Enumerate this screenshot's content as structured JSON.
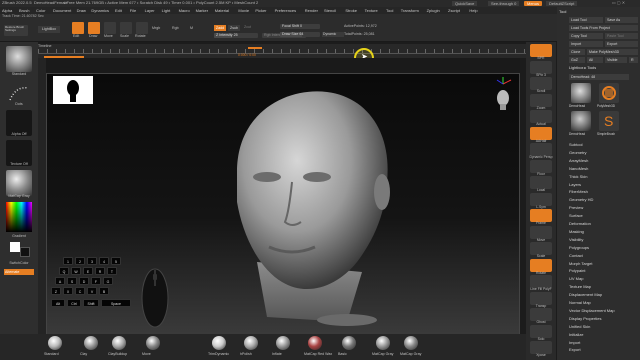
{
  "titlebar": {
    "app": "ZBrush 2022.0.5",
    "doc": "DemoHeadFemale",
    "stats": "• Free Mem 21.769GB • Active Mem 677 • Scratch Disk 49 • Timer 0.001 • PolyCount 2.5M KP • MeshCount 2",
    "quicksave": "QuickSave",
    "see_through": "See-through  0",
    "menus_btn": "Menus",
    "default_script": "DefaultZScript"
  },
  "menubar": [
    "Alpha",
    "Brush",
    "Color",
    "Document",
    "Draw",
    "Dynamics",
    "Edit",
    "File",
    "Layer",
    "Light",
    "Macro",
    "Marker",
    "Material",
    "Movie",
    "Picker",
    "Preferences",
    "Render",
    "Stencil",
    "Stroke",
    "Texture",
    "Tool",
    "Transform",
    "Zplugin",
    "Zscript",
    "Help"
  ],
  "track_time": "Track Time: 21.60782 Sec",
  "shelf": {
    "project_btn": "Restore Brush Settings",
    "lightbox": "LightBox",
    "buttons": [
      "Edit",
      "Draw",
      "Move",
      "Scale",
      "Rotate"
    ],
    "mrgb": "Mrgb",
    "rgb": "Rgb",
    "m": "M",
    "zadd": "Zadd",
    "zsub": "Zsub",
    "zcut": "Zcut",
    "focal_shift": "Focal Shift 0",
    "draw_size": "Draw Size 64",
    "dynamic": "Dynamic",
    "z_intensity": "Z Intensity 25",
    "rgb_intensity": "Rgb Intensity",
    "active_points": "ActivePoints: 12,972",
    "total_points": "TotalPoints: 25,081"
  },
  "timeline": {
    "label": "Timeline",
    "readout": "0:000 / 0:00"
  },
  "left_tray": {
    "brush_label": "Standard",
    "stroke_label": "Dots",
    "alpha_label": "Alpha Off",
    "texture_label": "Texture Off",
    "material_label": "MatCap Gray",
    "gradient_label": "Gradient",
    "switch_color": "SwitchColor",
    "alternate": "Alternate"
  },
  "right_col": [
    "BPR",
    "SPix 3",
    "Scroll",
    "Zoom",
    "Actual",
    "AAHalf",
    "Dynamic Persp",
    "Floor",
    "Local",
    "L.Sym",
    "Frame",
    "Move",
    "Scale",
    "Rotate",
    "Line Fill PolyF",
    "Transp",
    "Ghost",
    "Solo",
    "Xpose"
  ],
  "tool_panel": {
    "title": "Tool",
    "buttons": [
      "Load Tool",
      "Save As",
      "Load Tools From Project",
      "Copy Tool",
      "Paste Tool",
      "Import",
      "Export",
      "Clone",
      "Make PolyMesh3D",
      "GoZ",
      "All",
      "Visible",
      "R"
    ],
    "lightbox_tools": "Lightbox ▸ Tools",
    "current": "DemoHead: 48",
    "tool_names": [
      "DemoHead",
      "PolyMesh3D",
      "SimpleBrush",
      "DemoHead"
    ],
    "subpalettes": [
      "Subtool",
      "Geometry",
      "ArrayMesh",
      "NanoMesh",
      "Thick Skin",
      "Layers",
      "FiberMesh",
      "Geometry HD",
      "Preview",
      "Surface",
      "Deformation",
      "Masking",
      "Visibility",
      "Polygroups",
      "Contact",
      "Morph Target",
      "Polypaint",
      "UV Map",
      "Texture Map",
      "Displacement Map",
      "Normal Map",
      "Vector Displacement Map",
      "Display Properties",
      "Unified Skin",
      "Initialize",
      "Import",
      "Export"
    ]
  },
  "bottom_shelf": [
    "Standard",
    "Clay",
    "ClayBuildup",
    "Move",
    "TrimDynamic",
    "hPolish",
    "Inflate",
    "MatCap Red Wax",
    "Basic",
    "MatCap Gray",
    "MatCap Gray"
  ],
  "keyboard_keys": [
    "1",
    "2",
    "3",
    "4",
    "5",
    "Q",
    "W",
    "E",
    "R",
    "T",
    "A",
    "S",
    "D",
    "F",
    "G",
    "Z",
    "X",
    "C",
    "V",
    "B",
    "Alt",
    "Ctrl",
    "Shift",
    "Space"
  ],
  "colors": {
    "accent": "#e67e22",
    "panel": "#2d2d2d",
    "canvas": "#0e0e0e",
    "cursor_ring": "#e6d31a"
  },
  "icons": {
    "cursor": "cursor-arrow-icon",
    "axis": "axis-gizmo-icon",
    "mouse": "mouse-icon"
  }
}
